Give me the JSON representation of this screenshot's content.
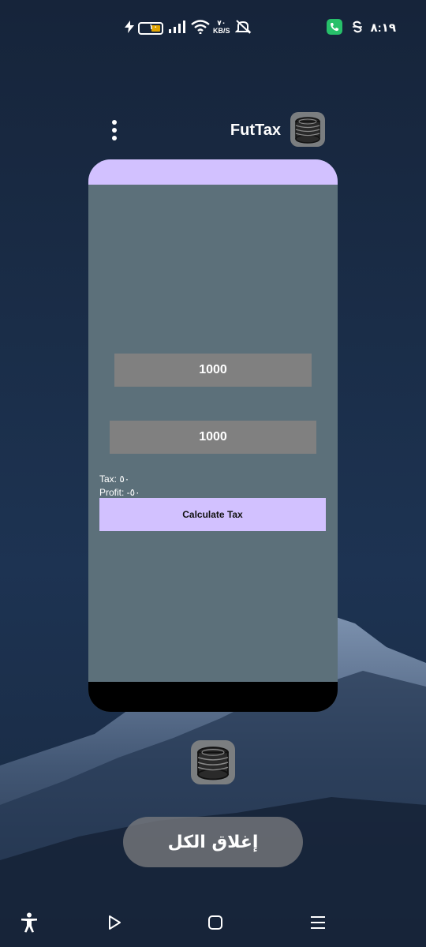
{
  "status_bar": {
    "time": "٨:١٩",
    "battery_level": "١٠",
    "speed_value": "٧٠",
    "speed_unit": "KB/S",
    "phone_color": "#27c06a"
  },
  "app": {
    "title": "FutTax",
    "accent_color": "#d2c1ff",
    "background_color": "#5c707a",
    "field_1_value": "1000",
    "field_2_value": "1000",
    "tax_text": "Tax: ٥٠",
    "profit_text": "Profit: -٥٠",
    "calculate_label": "Calculate Tax",
    "icon": "coins-icon"
  },
  "recents": {
    "close_all_label": "إغلاق الكل"
  },
  "navbar": {
    "icons": [
      "accessibility-icon",
      "back-icon",
      "home-icon",
      "recents-icon"
    ]
  }
}
